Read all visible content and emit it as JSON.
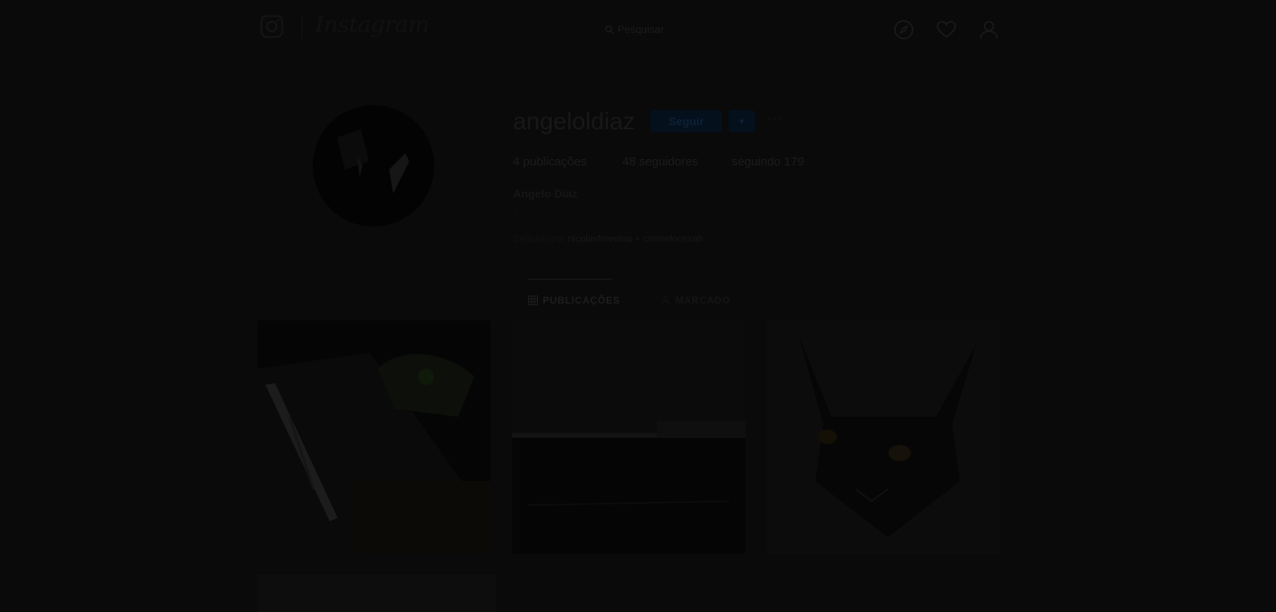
{
  "header": {
    "logo_text": "Instagram",
    "search_placeholder": "Pesquisar",
    "icons": [
      "compass-icon",
      "heart-icon",
      "user-icon"
    ]
  },
  "profile": {
    "username": "angeloldiaz",
    "follow_label": "Seguir",
    "dropdown_symbol": "▾",
    "more_symbol": "···",
    "stats": {
      "posts": "4 publicações",
      "followers": "48 seguidores",
      "following": "seguindo 179"
    },
    "full_name": "Angelo Díaz",
    "bio": "-",
    "followed_by_prefix": "Seguido por",
    "followed_by_names": "nicolasfmedina + carmeloosxah"
  },
  "tabs": [
    {
      "label": "PUBLICAÇÕES",
      "icon": "grid-icon",
      "active": true
    },
    {
      "label": "MARCADO",
      "icon": "tag-icon",
      "active": false
    }
  ],
  "posts": [
    {
      "subject": "laptop-keyboard"
    },
    {
      "subject": "skyline"
    },
    {
      "subject": "black-cat"
    }
  ],
  "colors": {
    "overlay_background": "#0a0a0a",
    "follow_button": "#04101c",
    "accent_text": "#0c2236"
  }
}
